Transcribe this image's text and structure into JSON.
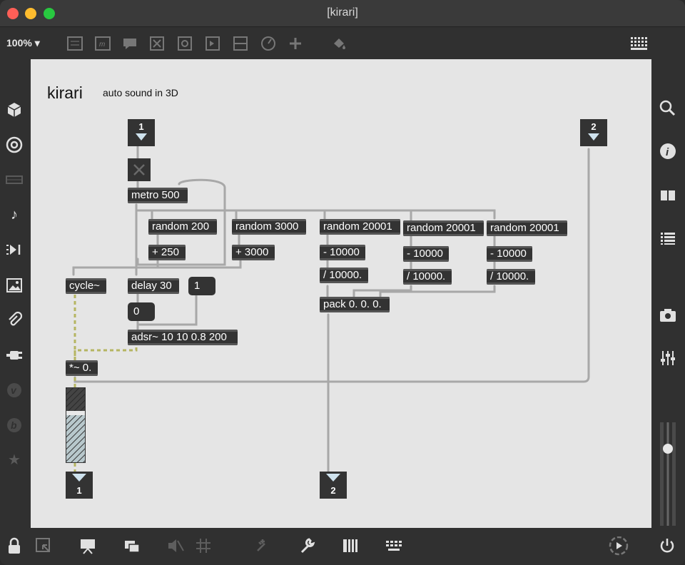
{
  "window": {
    "title": "[kirari]"
  },
  "toolbar": {
    "zoom": "100% ▾"
  },
  "patch": {
    "title": "kirari",
    "subtitle": "auto sound in 3D",
    "inlet1": "1",
    "inlet2": "2",
    "outlet1": "1",
    "outlet2": "2",
    "metro": "metro 500",
    "random200": "random 200",
    "plus250": "+ 250",
    "random3000": "random 3000",
    "plus3000": "+ 3000",
    "randA": "random 20001",
    "randB": "random 20001",
    "randC": "random 20001",
    "subA": "- 10000",
    "subB": "- 10000",
    "subC": "- 10000",
    "divA": "/ 10000.",
    "divB": "/ 10000.",
    "divC": "/ 10000.",
    "pack": "pack 0. 0. 0.",
    "cycle": "cycle~",
    "delay": "delay 30",
    "msg1": "1",
    "msg0": "0",
    "adsr": "adsr~ 10 10 0.8 200",
    "mult": "*~ 0."
  },
  "colors": {
    "object_bg": "#333333",
    "canvas_bg": "#e5e5e5",
    "cord": "#a8a8a8",
    "signal_cord": "#d9d96a"
  }
}
